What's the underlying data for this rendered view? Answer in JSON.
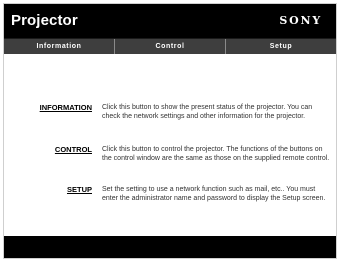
{
  "header": {
    "title": "Projector",
    "brand": "SONY"
  },
  "tabs": [
    {
      "label": "Information"
    },
    {
      "label": "Control"
    },
    {
      "label": "Setup"
    }
  ],
  "rows": [
    {
      "link": "INFORMATION",
      "description": "Click this button to show the present status of the projector. You can check the network settings and other information for the projector."
    },
    {
      "link": "CONTROL",
      "description": "Click this button to control the projector. The functions of the buttons on the control window are the same as those on the supplied remote control."
    },
    {
      "link": "SETUP",
      "description": "Set the setting to use a network function such as mail, etc.. You must enter the administrator name and password to display the Setup screen."
    }
  ]
}
